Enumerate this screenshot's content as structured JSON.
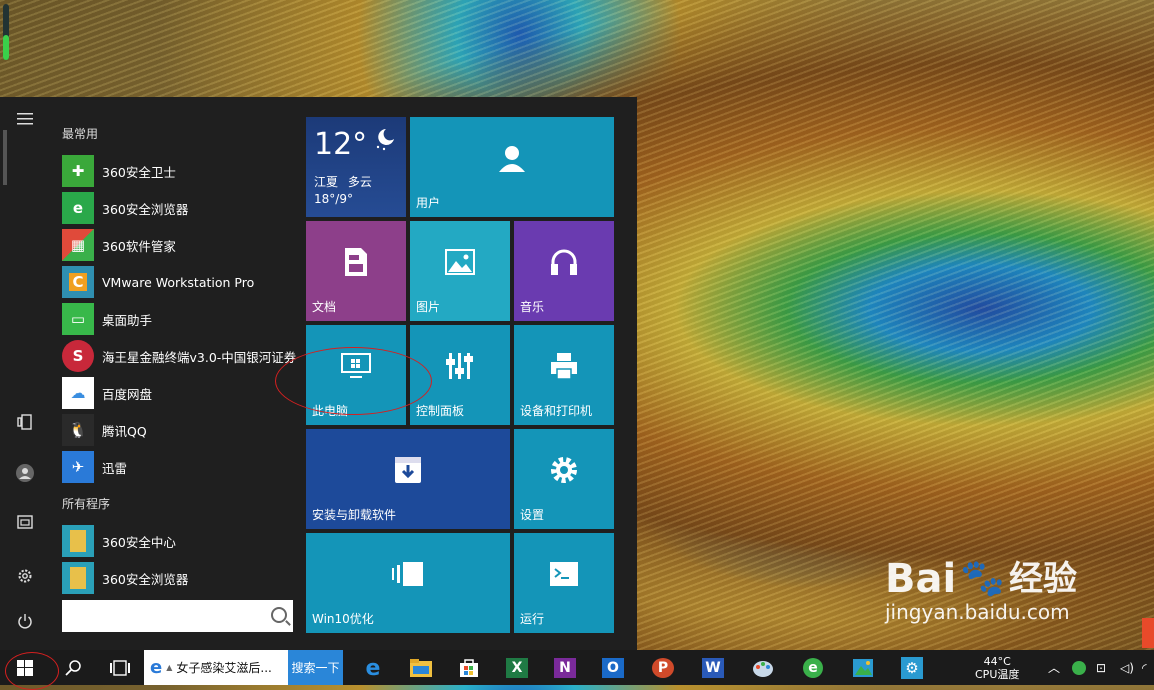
{
  "start_menu": {
    "most_used_label": "最常用",
    "all_programs_label": "所有程序",
    "most_used": [
      {
        "label": "360安全卫士",
        "icon": "360-safeguard-icon",
        "color": "#3aa83a"
      },
      {
        "label": "360安全浏览器",
        "icon": "360-browser-icon",
        "color": "#2aa84a"
      },
      {
        "label": "360软件管家",
        "icon": "360-software-manager-icon",
        "color": "#e04a3a"
      },
      {
        "label": "VMware Workstation Pro",
        "icon": "vmware-icon",
        "color": "#2f8fb0"
      },
      {
        "label": "桌面助手",
        "icon": "desktop-assistant-icon",
        "color": "#38b84a"
      },
      {
        "label": "海王星金融终端v3.0-中国银河证券",
        "icon": "neptune-finance-icon",
        "color": "#c8283a"
      },
      {
        "label": "百度网盘",
        "icon": "baidu-netdisk-icon",
        "color": "#3a8ee0"
      },
      {
        "label": "腾讯QQ",
        "icon": "qq-icon",
        "color": "#2a2a2a"
      },
      {
        "label": "迅雷",
        "icon": "xunlei-icon",
        "color": "#2a7ad8"
      }
    ],
    "all_programs": [
      {
        "label": "360安全中心",
        "icon": "folder-icon",
        "color": "#e8c04a"
      },
      {
        "label": "360安全浏览器",
        "icon": "folder-icon",
        "color": "#e8c04a"
      }
    ],
    "tiles": {
      "weather": {
        "temp": "12°",
        "city": "江夏",
        "condition": "多云",
        "range": "18°/9°"
      },
      "user": "用户",
      "documents": "文档",
      "pictures": "图片",
      "music": "音乐",
      "this_pc": "此电脑",
      "control_panel": "控制面板",
      "devices_printers": "设备和打印机",
      "install_uninstall": "安装与卸载软件",
      "settings": "设置",
      "win10_optimize": "Win10优化",
      "run": "运行"
    }
  },
  "taskbar": {
    "ie_title": "女子感染艾滋后...",
    "search_button": "搜索一下",
    "cpu_temp": "44°C",
    "cpu_label": "CPU温度"
  },
  "watermark": {
    "brand": "Bai",
    "cn": "经验",
    "url": "jingyan.baidu.com"
  }
}
